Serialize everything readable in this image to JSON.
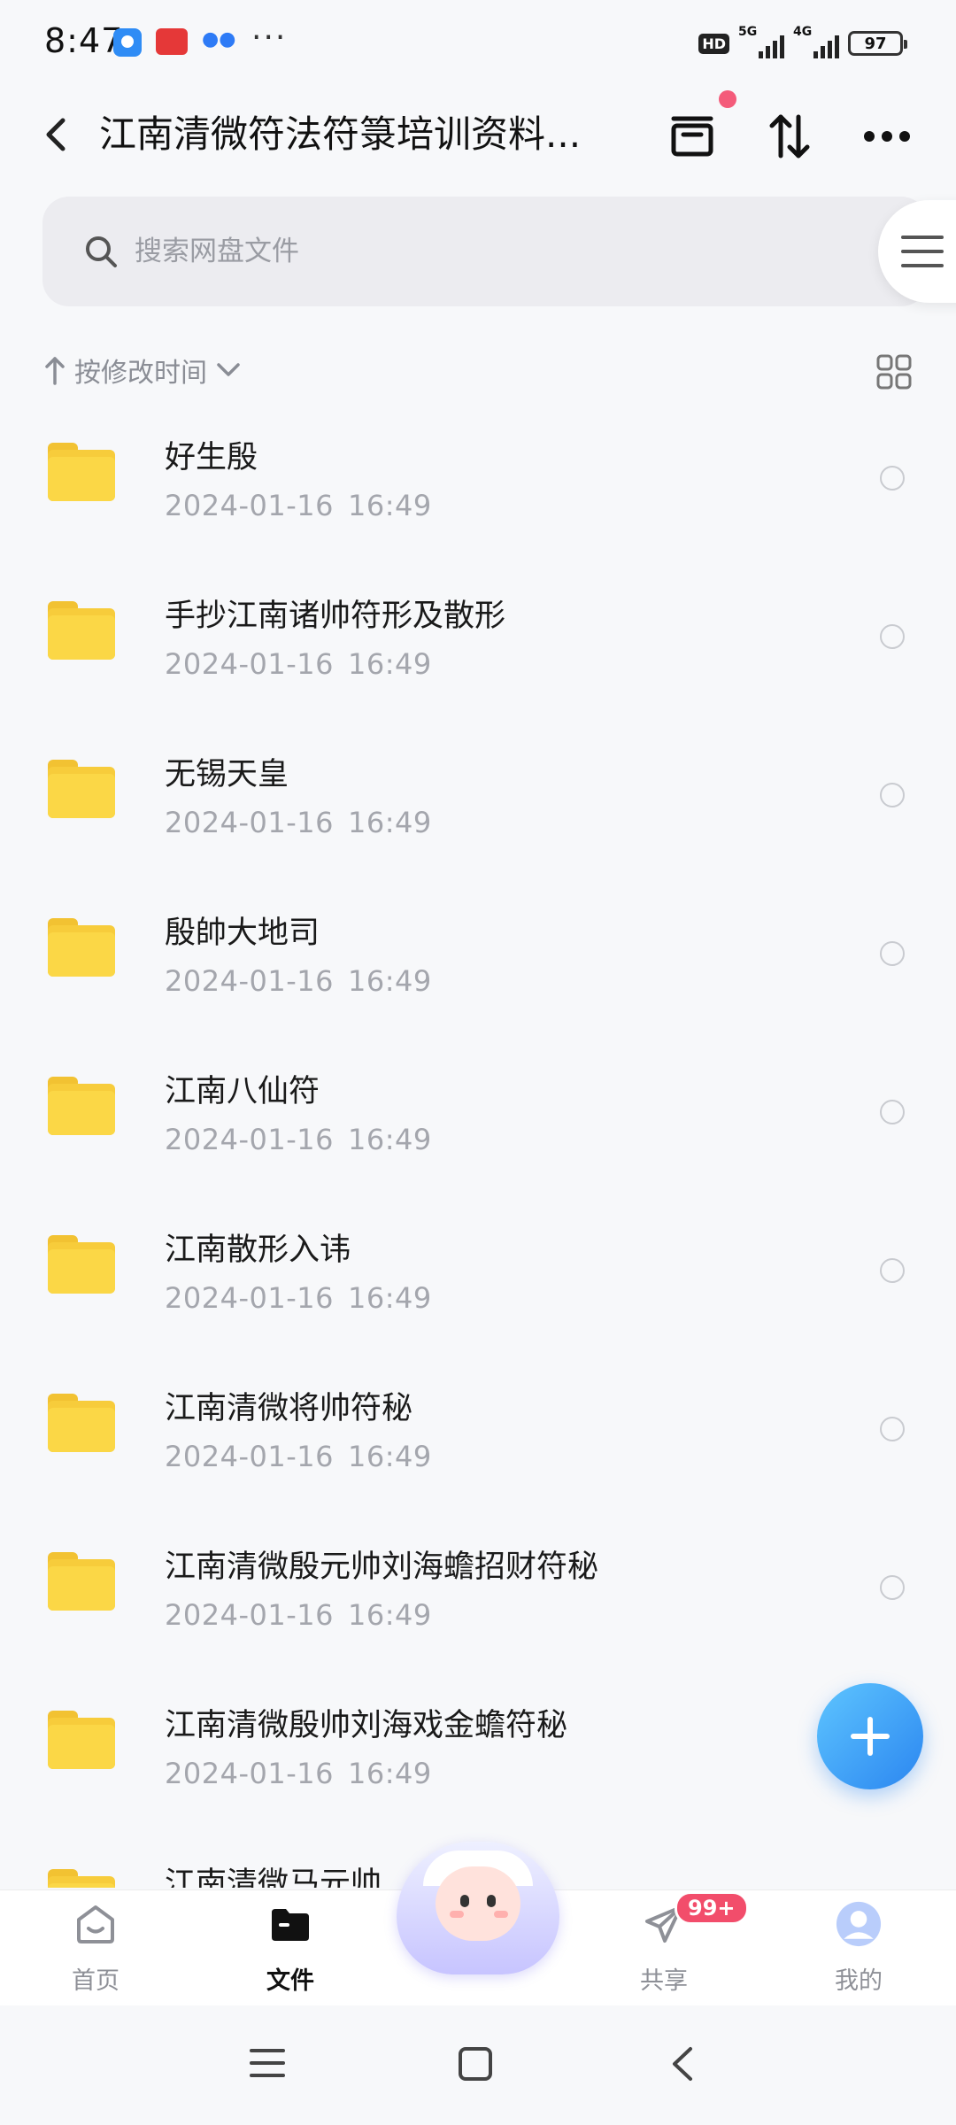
{
  "status_bar": {
    "time": "8:47",
    "hd": "HD",
    "net1": "5G",
    "net2": "4G",
    "battery": "97",
    "more": "···"
  },
  "header": {
    "title": "江南清微符法符箓培训资料..."
  },
  "search": {
    "placeholder": "搜索网盘文件"
  },
  "sort": {
    "label": "按修改时间"
  },
  "files": [
    {
      "name": "好生殷",
      "date": "2024-01-16",
      "time": "16:49"
    },
    {
      "name": "手抄江南诸帅符形及散形",
      "date": "2024-01-16",
      "time": "16:49"
    },
    {
      "name": "无锡天皇",
      "date": "2024-01-16",
      "time": "16:49"
    },
    {
      "name": "殷帥大地司",
      "date": "2024-01-16",
      "time": "16:49"
    },
    {
      "name": "江南八仙符",
      "date": "2024-01-16",
      "time": "16:49"
    },
    {
      "name": "江南散形入讳",
      "date": "2024-01-16",
      "time": "16:49"
    },
    {
      "name": "江南清微将帅符秘",
      "date": "2024-01-16",
      "time": "16:49"
    },
    {
      "name": "江南清微殷元帅刘海蟾招财符秘",
      "date": "2024-01-16",
      "time": "16:49"
    },
    {
      "name": "江南清微殷帅刘海戏金蟾符秘",
      "date": "2024-01-16",
      "time": "16:49"
    },
    {
      "name": "江南清微马元帅",
      "date": "",
      "time": ""
    }
  ],
  "bottom_nav": {
    "home": "首页",
    "files": "文件",
    "share": "共享",
    "share_badge": "99+",
    "me": "我的"
  },
  "colors": {
    "accent": "#2b86f0",
    "folder": "#f7cc3b",
    "badge": "#f24d6b"
  }
}
